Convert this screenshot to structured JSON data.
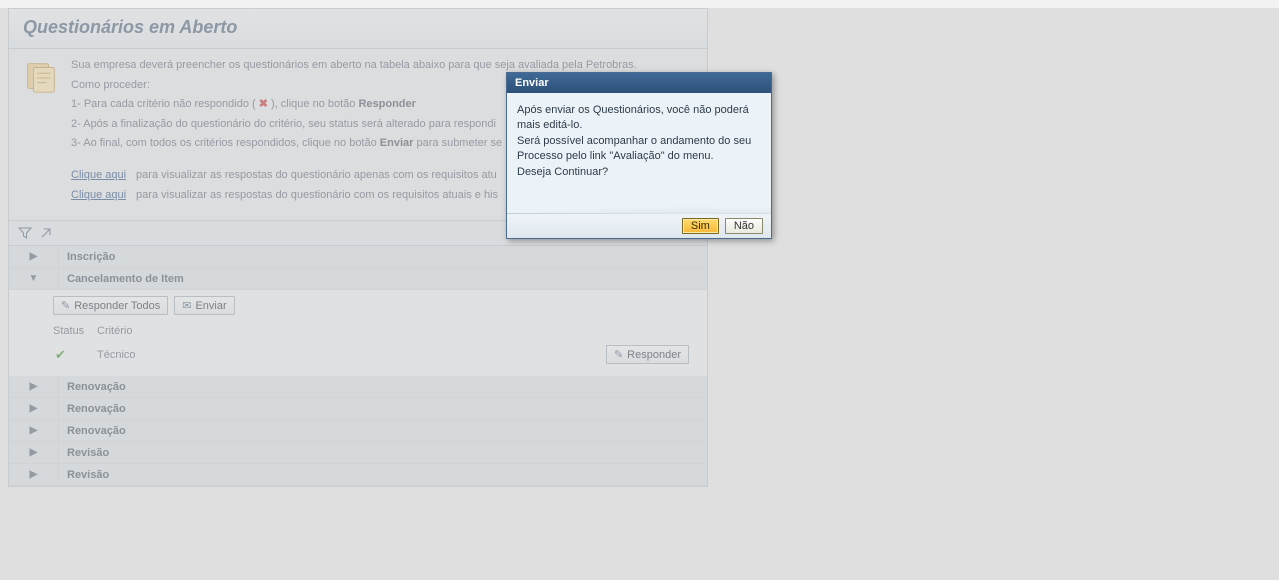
{
  "page": {
    "title": "Questionários em Aberto"
  },
  "intro": {
    "line1": "Sua empresa deverá preencher os questionários em aberto na tabela abaixo para que seja avaliada pela Petrobras.",
    "line2": "Como proceder:",
    "step1_pre": "1- Para cada critério não respondido ( ",
    "step1_post": " ), clique no botão ",
    "step1_bold": "Responder",
    "step2": "2- Após a finalização do questionário do critério, seu status será alterado para respondi",
    "step3_pre": "3- Ao final, com todos os critérios respondidos, clique no botão ",
    "step3_bold": "Enviar",
    "step3_post": " para submeter se"
  },
  "links": {
    "label": "Clique aqui",
    "desc1": "para visualizar as respostas do questionário apenas com os requisitos atu",
    "desc2": "para visualizar as respostas do questionário com os requisitos atuais e his"
  },
  "sections": [
    {
      "label": "Inscrição",
      "expanded": false
    },
    {
      "label": "Cancelamento de Item",
      "expanded": true
    },
    {
      "label": "Renovação",
      "expanded": false
    },
    {
      "label": "Renovação",
      "expanded": false
    },
    {
      "label": "Renovação",
      "expanded": false
    },
    {
      "label": "Revisão",
      "expanded": false
    },
    {
      "label": "Revisão",
      "expanded": false
    }
  ],
  "content": {
    "btn_responder_todos": "Responder Todos",
    "btn_enviar": "Enviar",
    "col_status": "Status",
    "col_criterio": "Critério",
    "row_criterio": "Técnico",
    "btn_responder": "Responder"
  },
  "dialog": {
    "title": "Enviar",
    "body_l1": "Após enviar os Questionários, você não poderá mais editá-lo.",
    "body_l2": "Será possível acompanhar o andamento do seu Processo pelo link \"Avaliação\" do menu.",
    "body_l3": "Deseja Continuar?",
    "btn_yes": "Sim",
    "btn_no": "Não"
  }
}
